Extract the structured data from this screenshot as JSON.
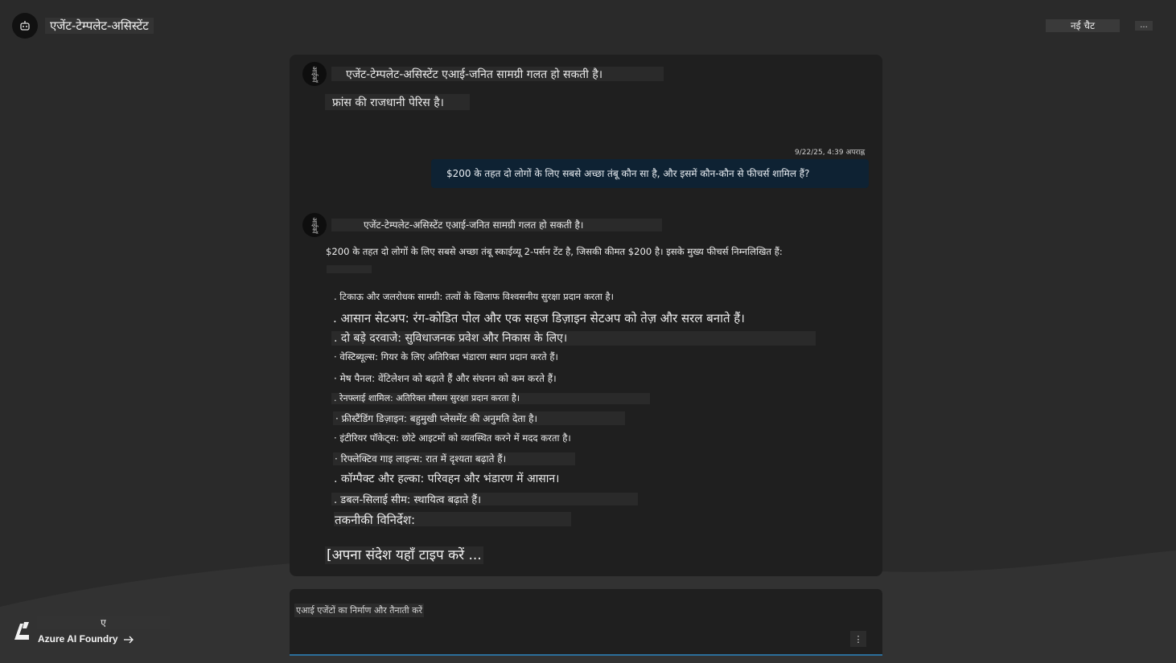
{
  "header": {
    "title": "एजेंट-टेम्पलेट-असिस्टेंट",
    "new_chat_label": "नई चैट",
    "more_label": "..."
  },
  "messages": {
    "first": {
      "avatar_label": "आईकॉ",
      "disclaimer": "एजेंट-टेम्पलेट-असिस्टेंट एआई-जनित सामग्री गलत हो सकती है।",
      "text": "फ्रांस की राजधानी पेरिस है।"
    },
    "user": {
      "timestamp": "9/22/25, 4:39 अपराह्न",
      "text": "$200 के तहत दो लोगों के लिए सबसे अच्छा तंबू कौन सा है, और इसमें कौन-कौन से फीचर्स शामिल हैं?"
    },
    "second": {
      "avatar_label": "आईकॉ",
      "disclaimer": "एजेंट-टेम्पलेट-असिस्टेंट एआई-जनित सामग्री गलत हो सकती है।",
      "intro": "$200 के तहत दो लोगों के लिए सबसे अच्छा तंबू स्काईव्यू 2-पर्सन टेंट है, जिसकी कीमत $200 है। इसके मुख्य फीचर्स निम्नलिखित हैं:",
      "features": [
        ". टिकाऊ और जलरोधक सामग्री: तत्वों के खिलाफ विश्वसनीय सुरक्षा प्रदान करता है।",
        ". आसान सेटअप: रंग-कोडित पोल और एक सहज डिज़ाइन सेटअप को तेज़ और सरल बनाते हैं।",
        ". दो बड़े दरवाजे: सुविधाजनक प्रवेश और निकास के लिए।",
        "· वेस्टिब्यूल्स: गियर के लिए अतिरिक्त भंडारण स्थान प्रदान करते हैं।",
        "· मेष पैनल: वेंटिलेशन को बढ़ाते हैं और संघनन को कम करते हैं।",
        ". रेनफ्लाई शामिल: अतिरिक्त मौसम सुरक्षा प्रदान करता है।",
        "· फ्रीस्टैंडिंग डिज़ाइन: बहुमुखी प्लेसमेंट की अनुमति देता है।",
        "· इंटीरियर पॉकेट्स: छोटे आइटमों को व्यवस्थित करने में मदद करता है।",
        "· रिफ्लेक्टिव गाइ लाइन्स: रात में दृश्यता बढ़ाते हैं।",
        ". कॉम्पैक्ट और हल्का: परिवहन और भंडारण में आसान।",
        ". डबल-सिलाई सीम: स्थायित्व बढ़ाते हैं।"
      ],
      "specs_heading": "तकनीकी विनिर्देश:"
    }
  },
  "input": {
    "placeholder": "[अपना संदेश यहाँ टाइप करें ..."
  },
  "compose": {
    "text": "एआई एजेंटों का निर्माण और तैनाती करें",
    "send_icon_label": "⋮"
  },
  "footer": {
    "ghost_label": "ए",
    "link_label": "Azure AI Foundry"
  },
  "colors": {
    "background": "#2a2a2a",
    "panel": "#1f1f1f",
    "user_bubble": "#0e2233",
    "accent": "#2b6e9b"
  }
}
